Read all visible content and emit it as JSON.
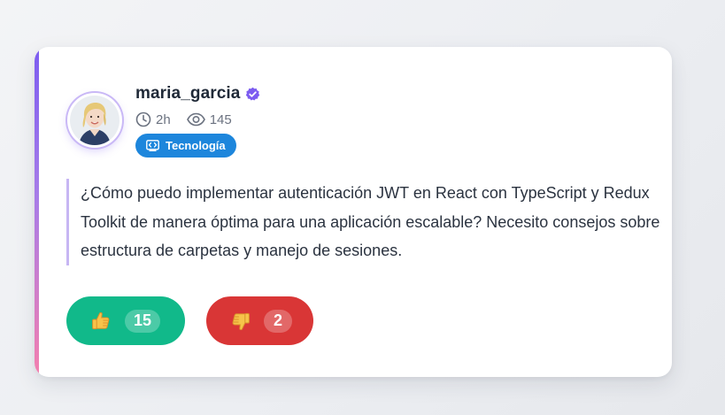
{
  "post": {
    "author": {
      "username": "maria_garcia",
      "verified": true,
      "avatar_icon": "user-photo-icon"
    },
    "meta": {
      "time_ago": "2h",
      "views": "145"
    },
    "tag": {
      "label": "Tecnología",
      "icon": "code-icon",
      "color": "#1d86dc"
    },
    "question": "¿Cómo puedo implementar autenticación JWT en React con TypeScript y Redux Toolkit de manera óptima para una aplicación escalable? Necesito consejos sobre estructura de carpetas y manejo de sesiones.",
    "reactions": {
      "likes": {
        "emoji": "👍",
        "count": "15",
        "color": "#11b98a"
      },
      "dislikes": {
        "emoji": "👎",
        "count": "2",
        "color": "#d93636"
      }
    },
    "accent_gradient": [
      "#7c5cf0",
      "#f47fae"
    ]
  }
}
